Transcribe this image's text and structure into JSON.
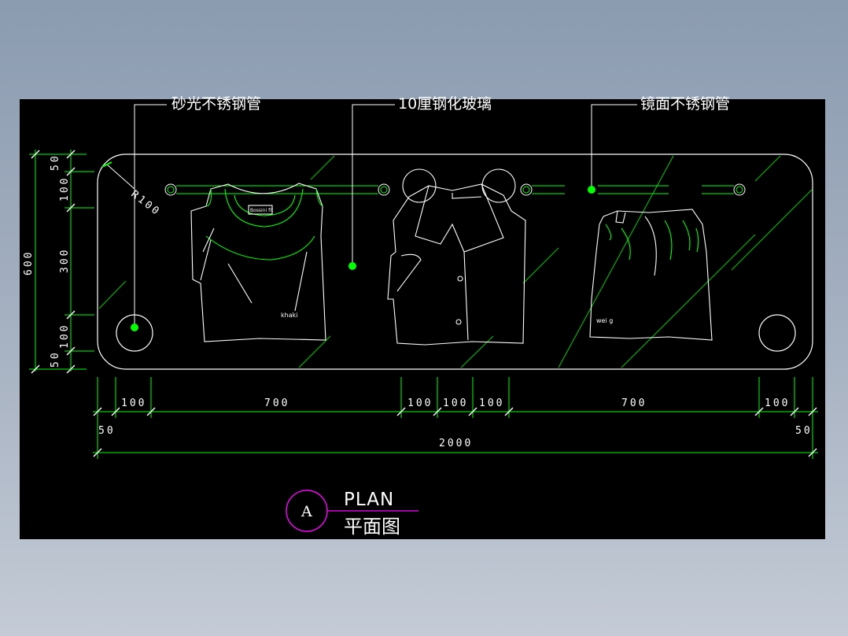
{
  "callouts": {
    "brushed_steel_tube": "砂光不锈钢管",
    "tempered_glass": "10厘钢化玻璃",
    "mirror_steel_tube": "镜面不锈钢管"
  },
  "radius_label": "R100",
  "garment_labels": {
    "tshirt_tag": "Bossini fit",
    "tshirt_text": "khaki",
    "skirt_text": "wei g"
  },
  "left_dims": {
    "total": "600",
    "segments": [
      "50",
      "100",
      "300",
      "100",
      "50"
    ]
  },
  "bottom_dims": {
    "segments": [
      "100",
      "700",
      "100",
      "100",
      "100",
      "700",
      "100"
    ],
    "edge_left": "50",
    "edge_right": "50",
    "total": "2000"
  },
  "title": {
    "marker": "A",
    "english": "PLAN",
    "chinese": "平面图"
  },
  "colors": {
    "background": "#000000",
    "outline": "#ffffff",
    "dimension": "#00ff00",
    "title_marker": "#ff00ff"
  }
}
